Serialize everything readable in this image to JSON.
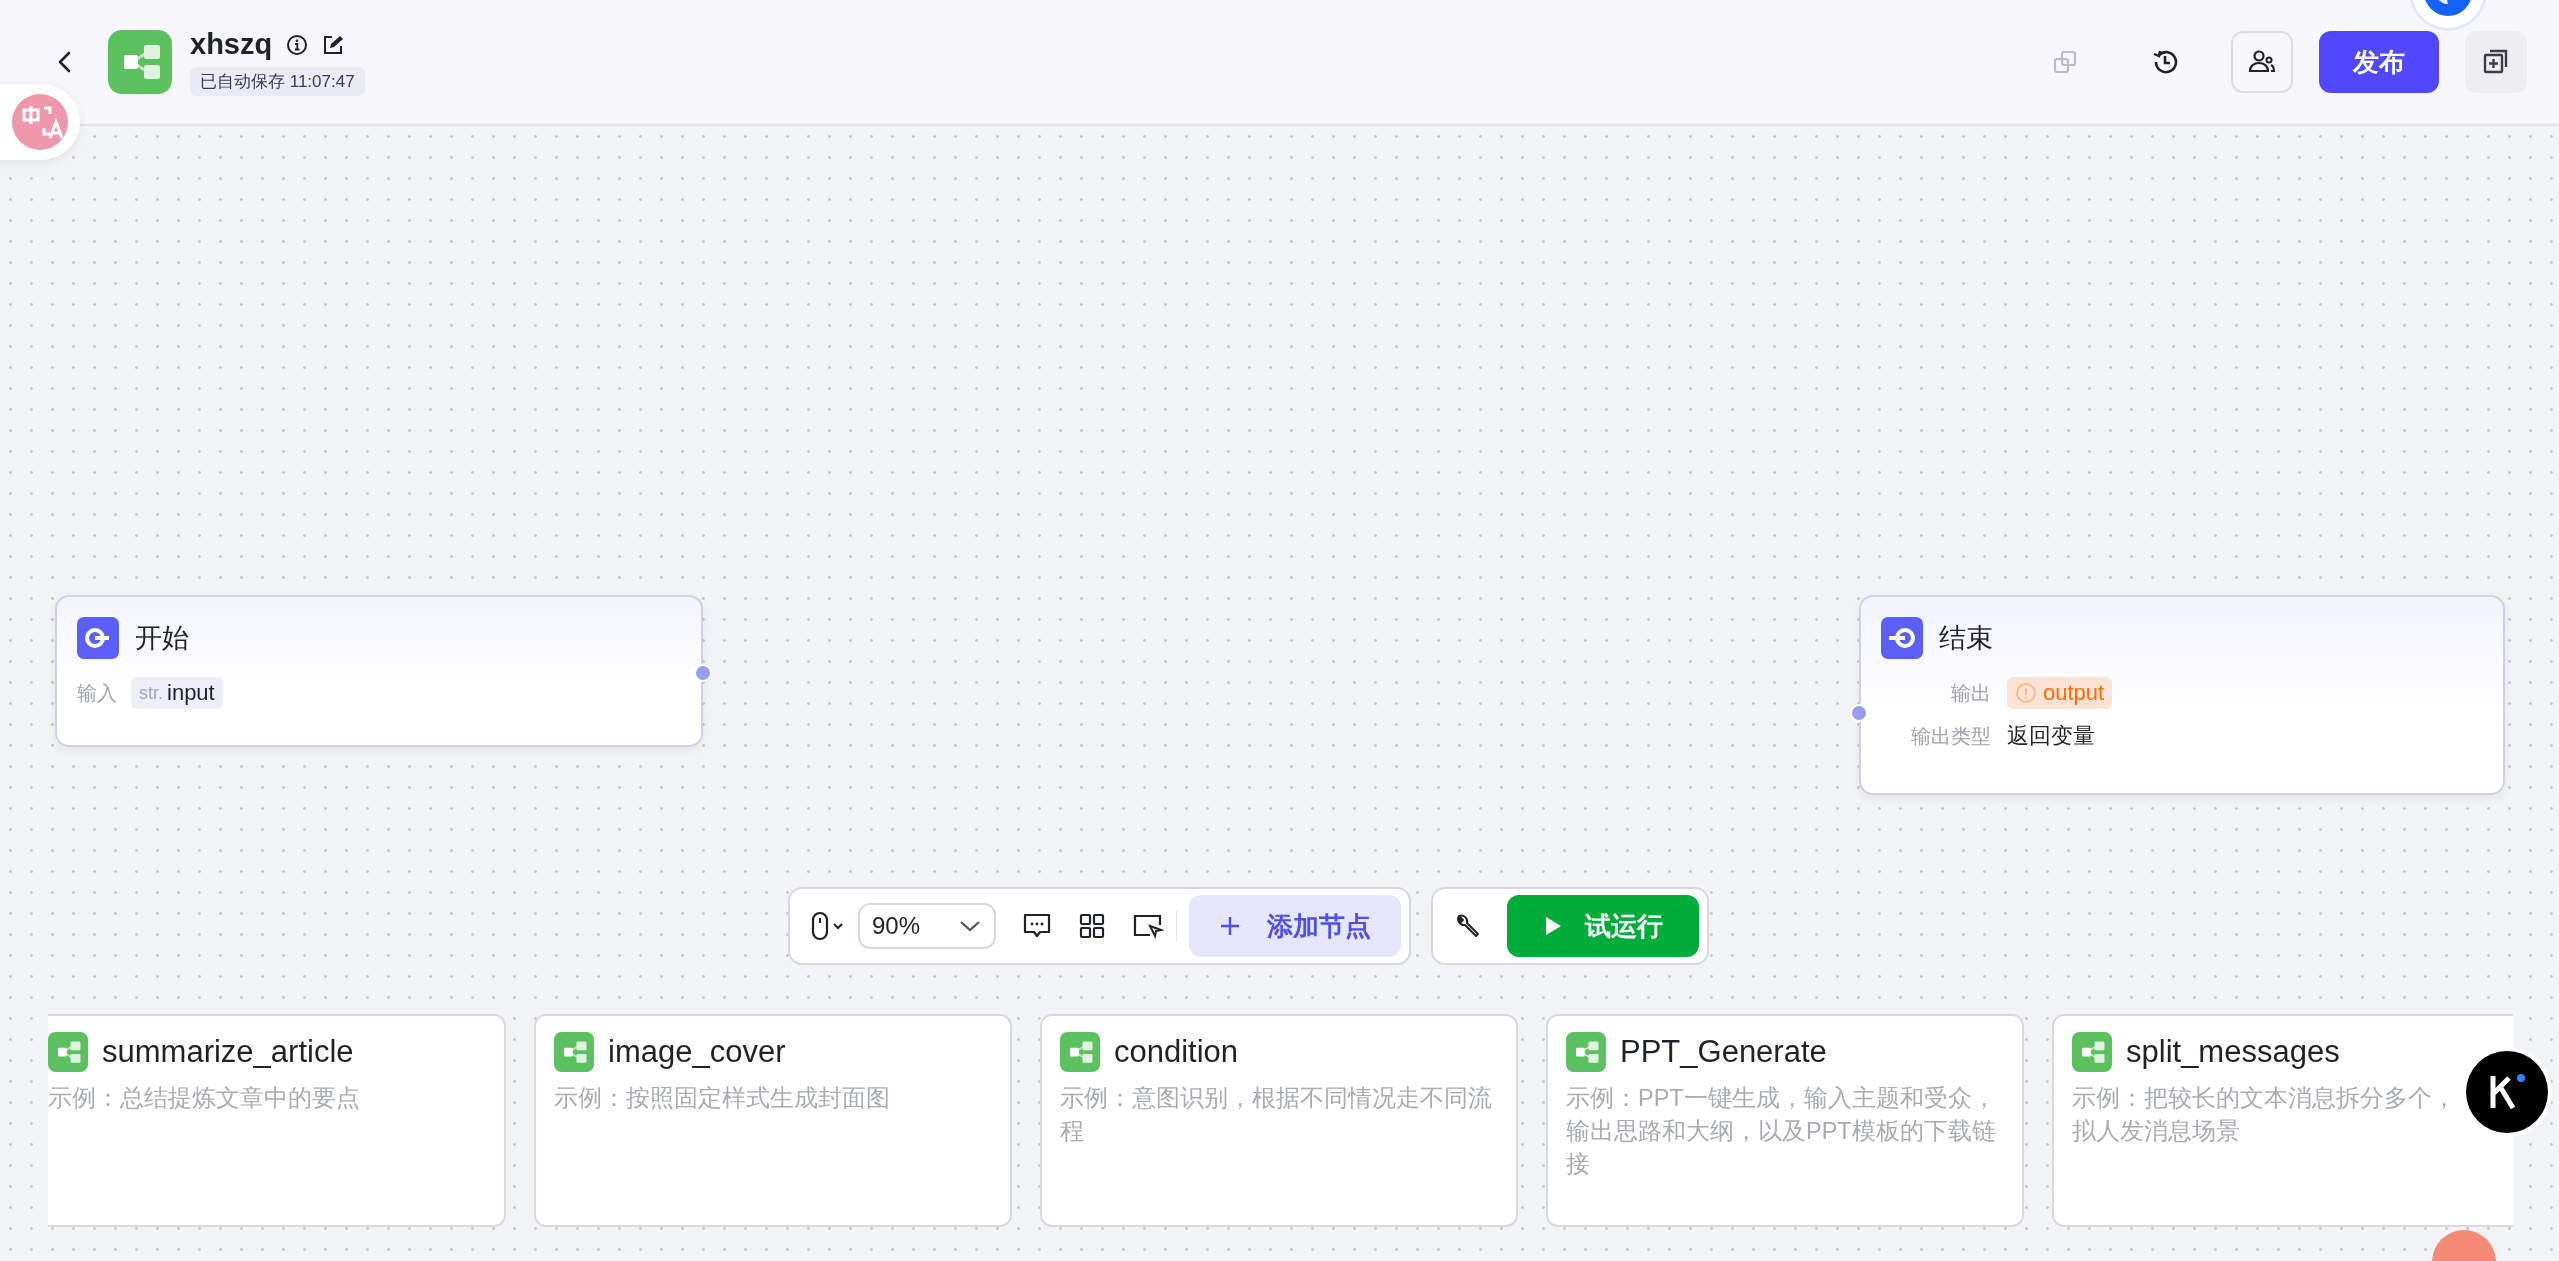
{
  "header": {
    "title": "xhszq",
    "autosave": "已自动保存 11:07:47",
    "publish_button": "发布"
  },
  "start_node": {
    "title": "开始",
    "input_label": "输入",
    "variable_type": "str.",
    "variable_name": "input"
  },
  "end_node": {
    "title": "结束",
    "output_label": "输出",
    "output_variable": "output",
    "warning": true,
    "output_type_label": "输出类型",
    "output_type": "返回变量"
  },
  "toolbar": {
    "zoom": "90%",
    "add_node_button": "添加节点",
    "test_run_button": "试运行"
  },
  "templates": [
    {
      "title": "summarize_article",
      "description": "示例：总结提炼文章中的要点"
    },
    {
      "title": "image_cover",
      "description": "示例：按照固定样式生成封面图"
    },
    {
      "title": "condition",
      "description": "示例：意图识别，根据不同情况走不同流程"
    },
    {
      "title": "PPT_Generate",
      "description": "示例：PPT一键生成，输入主题和受众，输出思路和大纲，以及PPT模板的下载链接"
    },
    {
      "title": "split_messages",
      "description": "示例：把较长的文本消息拆分多个，拟人发消息场景"
    }
  ]
}
